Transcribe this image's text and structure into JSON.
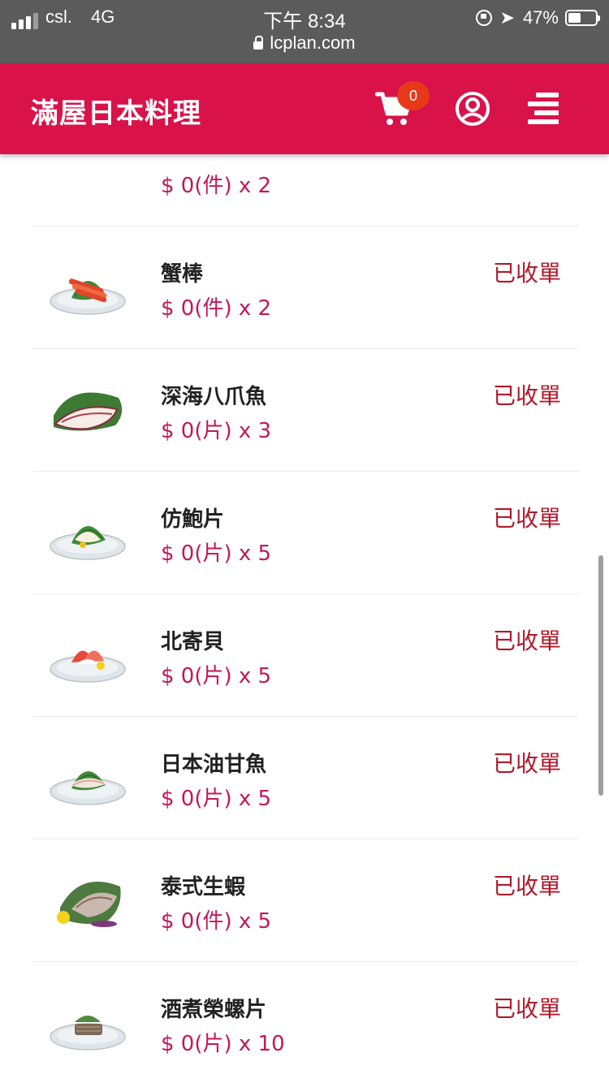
{
  "status_bar": {
    "carrier": "csl.",
    "network": "4G",
    "time": "下午 8:34",
    "battery_percent": "47%",
    "battery_level": 0.47,
    "url": "lcplan.com",
    "icons": [
      "signal-icon",
      "rotation-lock-icon",
      "location-arrow-icon",
      "battery-icon",
      "lock-icon"
    ]
  },
  "header": {
    "brand": "滿屋日本料理",
    "cart_count": "0",
    "background_color": "#d9124a",
    "icons": [
      "cart-icon",
      "user-icon",
      "menu-icon"
    ]
  },
  "colors": {
    "price": "#c2185b",
    "status": "#b01a2c"
  },
  "orders": [
    {
      "name": "",
      "price": "$ 0(件) x 2",
      "status": "",
      "thumb": "sashimi-plate-icon",
      "partial": true
    },
    {
      "name": "蟹棒",
      "price": "$ 0(件) x 2",
      "status": "已收單",
      "thumb": "crab-stick-plate-icon"
    },
    {
      "name": "深海八爪魚",
      "price": "$ 0(片) x 3",
      "status": "已收單",
      "thumb": "octopus-sashimi-icon"
    },
    {
      "name": "仿鮑片",
      "price": "$ 0(片) x 5",
      "status": "已收單",
      "thumb": "abalone-slice-plate-icon"
    },
    {
      "name": "北寄貝",
      "price": "$ 0(片) x 5",
      "status": "已收單",
      "thumb": "surf-clam-plate-icon"
    },
    {
      "name": "日本油甘魚",
      "price": "$ 0(片) x 5",
      "status": "已收單",
      "thumb": "yellowtail-plate-icon"
    },
    {
      "name": "泰式生蝦",
      "price": "$ 0(件) x 5",
      "status": "已收單",
      "thumb": "thai-shrimp-plate-icon"
    },
    {
      "name": "酒煮榮螺片",
      "price": "$ 0(片) x 10",
      "status": "已收單",
      "thumb": "turban-shell-plate-icon"
    }
  ]
}
